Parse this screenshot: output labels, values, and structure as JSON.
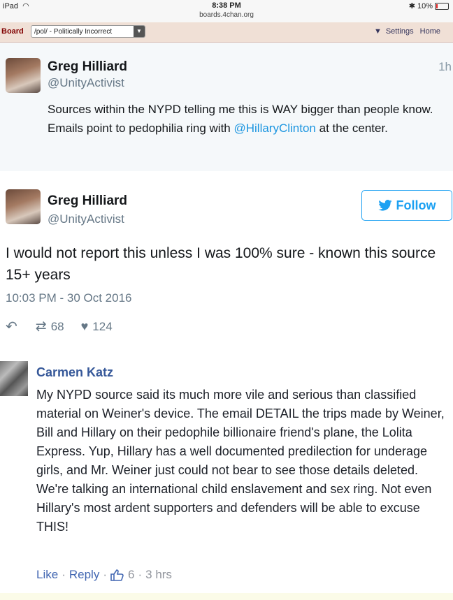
{
  "status_bar": {
    "device": "iPad",
    "time": "8:38 PM",
    "url": "boards.4chan.org",
    "battery": "10%",
    "battery_level": 0.1
  },
  "board_bar": {
    "label": "Board",
    "selected_board": "/pol/ - Politically Incorrect",
    "settings_label": "Settings",
    "home_label": "Home"
  },
  "tweet1": {
    "name": "Greg Hilliard",
    "handle": "@UnityActivist",
    "time": "1h",
    "line1": "Sources within the NYPD telling me this is WAY bigger than people know.",
    "line2_before": "Emails point to pedophilia ring with ",
    "mention": "@HillaryClinton",
    "line2_after": " at the center."
  },
  "tweet2": {
    "name": "Greg Hilliard",
    "handle": "@UnityActivist",
    "follow_label": "Follow",
    "text": "I would not report this unless I was 100% sure - known this source 15+ years",
    "date": "10:03 PM - 30 Oct 2016",
    "retweets": "68",
    "likes": "124"
  },
  "comment": {
    "name": "Carmen Katz",
    "text": "My NYPD source said its much more vile and serious than classified material on Weiner's device. The email DETAIL the trips made by Weiner, Bill and Hillary on their pedophile billionaire friend's plane, the Lolita Express. Yup, Hillary has a well documented predilection for underage girls, and Mr. Weiner just could not bear to see those details deleted. We're talking an international child enslavement and sex ring. Not even Hillary's most ardent supporters and defenders will be able to excuse THIS!",
    "like_label": "Like",
    "reply_label": "Reply",
    "like_count": "6",
    "time": "3 hrs"
  }
}
